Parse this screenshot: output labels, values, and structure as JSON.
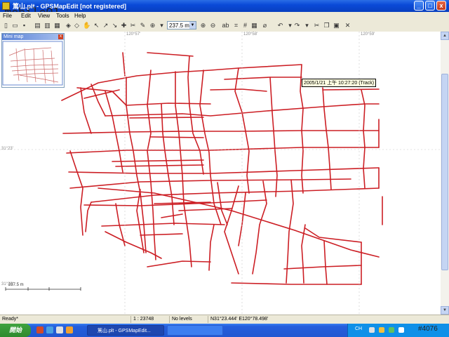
{
  "window": {
    "title": "篤山.plt - GPSMapEdit [not registered]",
    "minimize": "_",
    "maximize": "□",
    "close": "x"
  },
  "watermark": "mobile01",
  "menu": [
    "File",
    "Edit",
    "View",
    "Tools",
    "Help"
  ],
  "toolbar": {
    "zoom_value": "237.5 m"
  },
  "minimap": {
    "title": "Mini map",
    "close": "x"
  },
  "map": {
    "tooltip": "2005/1/21 上午 10:27:20 (Track)",
    "lon_labels": [
      "120°57'",
      "120°58'",
      "120°59'"
    ],
    "lat_labels": [
      "31°23'",
      "31°22'"
    ],
    "scale_label": "237.5 m"
  },
  "status": {
    "state": "Ready*",
    "scale": "1 : 23748",
    "levels": "No levels",
    "coords": "N31°23.444' E120°78.498'"
  },
  "taskbar": {
    "start": "開始",
    "task1": "篤山.plt - GPSMapEdit...",
    "task2": "",
    "tray_lang": "CH",
    "tray_badge": "#4076"
  },
  "colors": {
    "road": "#cc1e24",
    "titlebar": "#0a4ad8",
    "taskbar": "#245edc"
  }
}
